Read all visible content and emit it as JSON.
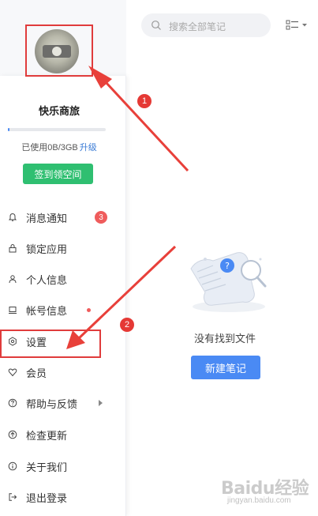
{
  "profile": {
    "username": "快乐商旅"
  },
  "storage": {
    "used_text": "已使用0B/3GB",
    "upgrade_label": "升级",
    "used_fraction": 0.0
  },
  "checkin": {
    "label": "签到领空间"
  },
  "menu": {
    "items": [
      {
        "label": "消息通知",
        "icon": "bell-icon",
        "badge": "3"
      },
      {
        "label": "锁定应用",
        "icon": "lock-icon"
      },
      {
        "label": "个人信息",
        "icon": "person-icon"
      },
      {
        "label": "帐号信息",
        "icon": "laptop-icon"
      },
      {
        "label": "设置",
        "icon": "gear-icon"
      },
      {
        "label": "会员",
        "icon": "heart-icon"
      },
      {
        "label": "帮助与反馈",
        "icon": "help-icon"
      },
      {
        "label": "检查更新",
        "icon": "upgrade-icon"
      },
      {
        "label": "关于我们",
        "icon": "info-icon"
      },
      {
        "label": "退出登录",
        "icon": "logout-icon"
      }
    ]
  },
  "search": {
    "placeholder": "搜索全部笔记"
  },
  "empty_state": {
    "text": "没有找到文件",
    "new_note_label": "新建笔记"
  },
  "annotations": {
    "step1": "1",
    "step2": "2",
    "highlight_color": "#e03c3c"
  },
  "watermark": {
    "text": "Baidu经验",
    "sub": "jingyan.baidu.com"
  },
  "colors": {
    "accent_blue": "#4a8af4",
    "checkin_green": "#2fbf71",
    "badge_red": "#ef5c5c"
  }
}
